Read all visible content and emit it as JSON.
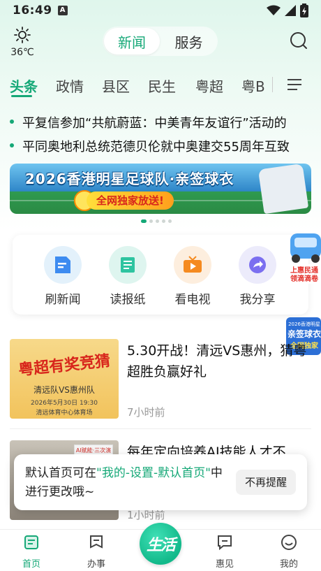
{
  "status_bar": {
    "time": "16:49",
    "sim_badge": "A"
  },
  "weather": {
    "icon": "sun-icon",
    "temp": "36℃"
  },
  "top_tabs": {
    "news": "新闻",
    "service": "服务"
  },
  "channels": [
    "头条",
    "政情",
    "县区",
    "民生",
    "粤超",
    "粤B"
  ],
  "ticker": [
    "平复信参加“共航蔚蓝：中美青年友谊行”活动的",
    "平同奥地利总统范德贝伦就中奥建交55周年互致"
  ],
  "banner": {
    "title": "2026香港明星足球队·亲签球衣",
    "cta": "全网独家放送!"
  },
  "quick_actions": [
    {
      "label": "刷新闻",
      "icon": "news-doc-icon"
    },
    {
      "label": "读报纸",
      "icon": "newspaper-icon"
    },
    {
      "label": "看电视",
      "icon": "tv-icon"
    },
    {
      "label": "我分享",
      "icon": "share-icon"
    }
  ],
  "float_ads": {
    "ad1": "上惠民通 领滴滴卷",
    "ad2": "2026香港明星 亲签球衣 全网独家"
  },
  "news": [
    {
      "title": "5.30开战！清远VS惠州，猜粤超胜负赢好礼",
      "time": "7小时前",
      "thumb": {
        "headline": "粤超有奖竞猜",
        "teams": "清远队VS惠州队",
        "date": "2026年5月30日 19:30",
        "venue": "清远体育中心体育场"
      }
    },
    {
      "title": "每年定向培养AI技能人才不",
      "time": "1小时前",
      "thumb": {
        "screen_text": "AI赋能·三次演讲"
      }
    }
  ],
  "toast": {
    "text_prefix": "默认首页可在",
    "highlight": "\"我的-设置-默认首页\"",
    "text_suffix": "中进行更改哦~",
    "button": "不再提醒"
  },
  "tab_bar": [
    {
      "label": "首页",
      "icon": "home-icon",
      "active": true
    },
    {
      "label": "办事",
      "icon": "bookmark-icon",
      "active": false
    },
    {
      "label": "生活",
      "icon": "life-logo-icon",
      "active": false
    },
    {
      "label": "惠见",
      "icon": "chat-icon",
      "active": false
    },
    {
      "label": "我的",
      "icon": "smile-icon",
      "active": false
    }
  ],
  "colors": {
    "accent": "#15a877",
    "banner_red": "#d8261c"
  }
}
